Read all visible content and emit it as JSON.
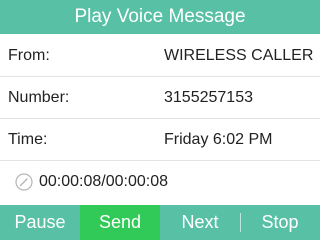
{
  "title": "Play Voice Message",
  "fields": {
    "from": {
      "label": "From:",
      "value": "WIRELESS CALLER"
    },
    "number": {
      "label": "Number:",
      "value": "3155257153"
    },
    "time": {
      "label": "Time:",
      "value": "Friday 6:02 PM"
    }
  },
  "playback": {
    "icon": "progress-clock-icon",
    "elapsed_total": "00:00:08/00:00:08"
  },
  "softkeys": {
    "pause": "Pause",
    "send": "Send",
    "next": "Next",
    "stop": "Stop"
  },
  "colors": {
    "accent": "#58c1a5",
    "active_softkey": "#31c958"
  }
}
